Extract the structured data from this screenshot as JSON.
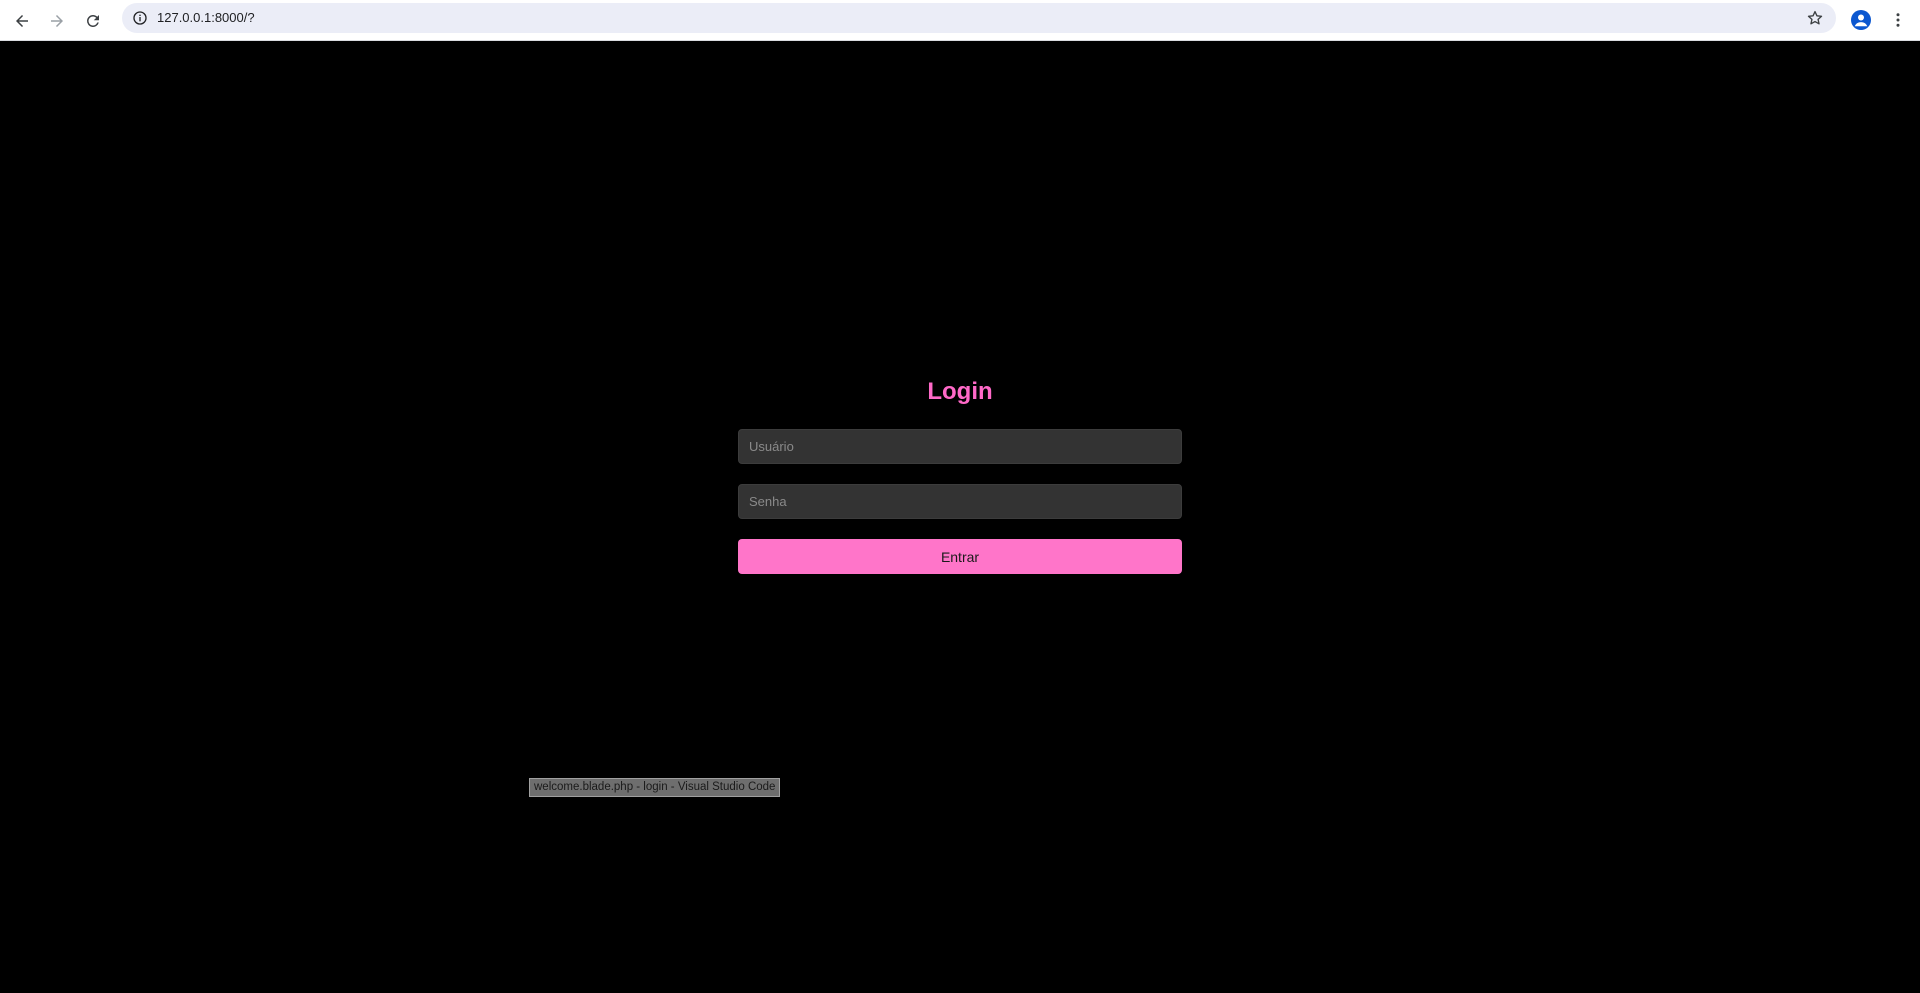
{
  "browser": {
    "url": "127.0.0.1:8000/?",
    "back_icon": "arrow-left-icon",
    "forward_icon": "arrow-right-icon",
    "reload_icon": "reload-icon",
    "site_info_icon": "info-icon",
    "bookmark_icon": "star-icon",
    "profile_icon": "person-icon",
    "menu_icon": "kebab-menu-icon"
  },
  "login": {
    "title": "Login",
    "username_placeholder": "Usuário",
    "password_placeholder": "Senha",
    "submit_label": "Entrar"
  },
  "tooltip": {
    "text": "welcome.blade.php - login - Visual Studio Code"
  },
  "colors": {
    "page_background": "#000000",
    "accent": "#ff69c8",
    "button_background": "#ff75c9",
    "input_background": "#333333"
  }
}
